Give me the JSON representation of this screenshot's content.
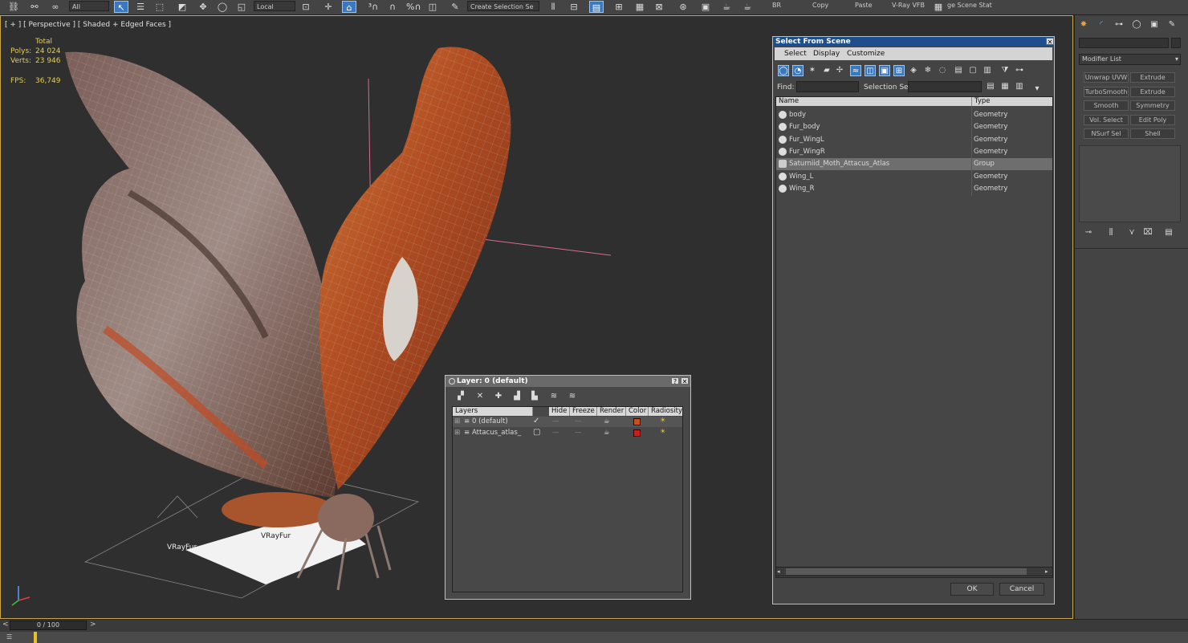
{
  "toolbar": {
    "filter_value": "All",
    "coord_value": "Local",
    "selection_set_placeholder": "Create Selection Se",
    "br_label": "BR",
    "copy_label": "Copy",
    "paste_label": "Paste",
    "vfb_label": "V-Ray VFB",
    "state_label": "ge Scene Stat"
  },
  "viewport": {
    "label": "[ + ] [ Perspective ] [ Shaded + Edged Faces ]",
    "stats_total": "Total",
    "polys_label": "Polys:",
    "polys_value": "24 024",
    "verts_label": "Verts:",
    "verts_value": "23 946",
    "fps_label": "FPS:",
    "fps_value": "36,749",
    "vrayfur_label_1": "VRayFur",
    "vrayfur_label_2": "VRayFur"
  },
  "select_dialog": {
    "title": "Select From Scene",
    "menu": [
      "Select",
      "Display",
      "Customize"
    ],
    "find_label": "Find:",
    "selection_set_label": "Selection Set:",
    "columns": [
      "Name",
      "Type"
    ],
    "rows": [
      {
        "name": "body",
        "type": "Geometry"
      },
      {
        "name": "Fur_body",
        "type": "Geometry"
      },
      {
        "name": "Fur_WingL",
        "type": "Geometry"
      },
      {
        "name": "Fur_WingR",
        "type": "Geometry"
      },
      {
        "name": "Saturniid_Moth_Attacus_Atlas",
        "type": "Group"
      },
      {
        "name": "Wing_L",
        "type": "Geometry"
      },
      {
        "name": "Wing_R",
        "type": "Geometry"
      }
    ],
    "ok_label": "OK",
    "cancel_label": "Cancel"
  },
  "layer_dialog": {
    "title": "Layer: 0 (default)",
    "help_label": "?",
    "columns": [
      "Layers",
      "Hide",
      "Freeze",
      "Render",
      "Color",
      "Radiosity"
    ],
    "rows": [
      {
        "name": "0 (default)",
        "check": "✓",
        "color": "#c8501e"
      },
      {
        "name": "Attacus_atlas_",
        "check": "▢",
        "color": "#c81e1e"
      }
    ]
  },
  "command_panel": {
    "modifier_list_label": "Modifier List",
    "modifiers": [
      "Unwrap UVW",
      "Extrude",
      "TurboSmooth",
      "Extrude",
      "Smooth",
      "Symmetry",
      "Vol. Select",
      "Edit Poly",
      "NSurf Sel",
      "Shell"
    ]
  },
  "timeline": {
    "frame_label": "0 / 100",
    "prev": "<",
    "next": ">"
  }
}
